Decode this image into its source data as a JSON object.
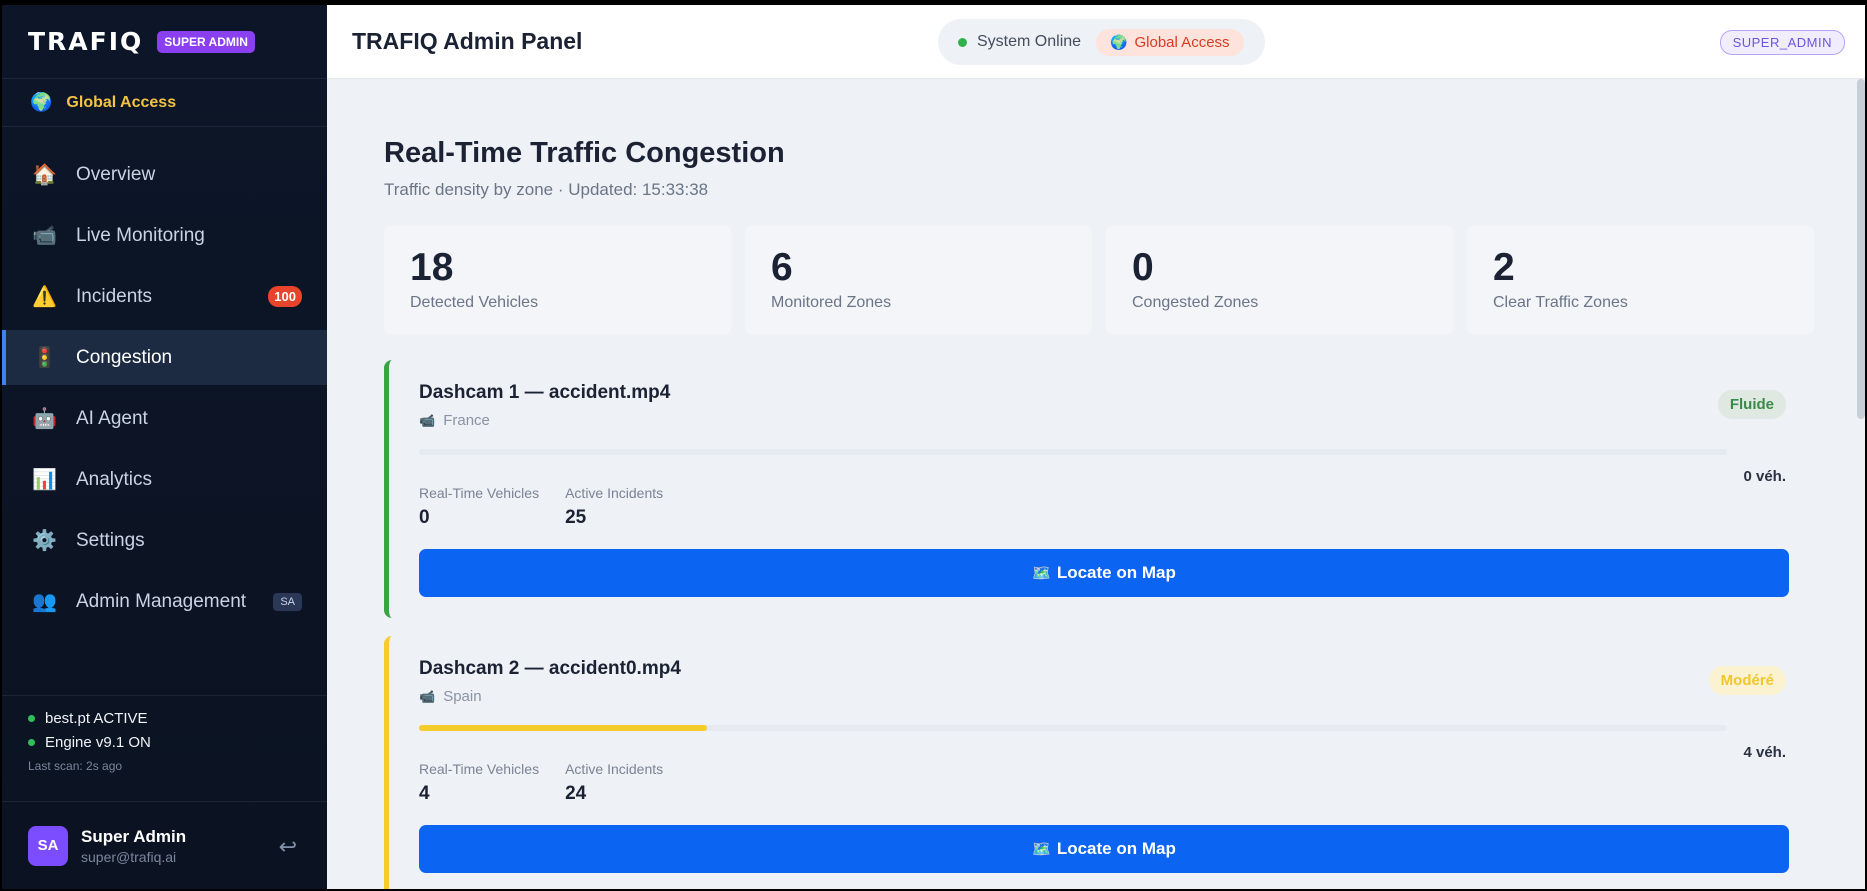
{
  "sidebar": {
    "logo": "TRAFIQ",
    "badge": "SUPER ADMIN",
    "scope": "Global Access",
    "items": [
      {
        "label": "Overview",
        "icon": "🏠"
      },
      {
        "label": "Live Monitoring",
        "icon": "📹"
      },
      {
        "label": "Incidents",
        "icon": "⚠️",
        "badge": "100"
      },
      {
        "label": "Congestion",
        "icon": "🚦"
      },
      {
        "label": "AI Agent",
        "icon": "🤖"
      },
      {
        "label": "Analytics",
        "icon": "📊"
      },
      {
        "label": "Settings",
        "icon": "⚙️"
      },
      {
        "label": "Admin Management",
        "icon": "👥",
        "badge": "SA"
      }
    ],
    "status": {
      "model": "best.pt ACTIVE",
      "engine": "Engine v9.1 ON",
      "last_scan": "Last scan: 2s ago"
    },
    "user": {
      "initials": "SA",
      "name": "Super Admin",
      "email": "super@trafiq.ai"
    }
  },
  "header": {
    "title": "TRAFIQ Admin Panel",
    "system_status": "System Online",
    "access": "Global Access",
    "role": "SUPER_ADMIN"
  },
  "page": {
    "title": "Real-Time Traffic Congestion",
    "subtitle": "Traffic density by zone · Updated: 15:33:38"
  },
  "stats": [
    {
      "value": "18",
      "label": "Detected Vehicles"
    },
    {
      "value": "6",
      "label": "Monitored Zones"
    },
    {
      "value": "0",
      "label": "Congested Zones"
    },
    {
      "value": "2",
      "label": "Clear Traffic Zones"
    }
  ],
  "cards": [
    {
      "title": "Dashcam 1 — accident.mp4",
      "location": "France",
      "status": "Fluide",
      "vehicles_label": "0 véh.",
      "density_fraction": 0.0,
      "metric1_label": "Real-Time Vehicles",
      "metric1_value": "0",
      "metric2_label": "Active Incidents",
      "metric2_value": "25",
      "button": "Locate on Map"
    },
    {
      "title": "Dashcam 2 — accident0.mp4",
      "location": "Spain",
      "status": "Modéré",
      "vehicles_label": "4 véh.",
      "density_fraction": 0.22,
      "metric1_label": "Real-Time Vehicles",
      "metric1_value": "4",
      "metric2_label": "Active Incidents",
      "metric2_value": "24",
      "button": "Locate on Map"
    }
  ],
  "colors": {
    "accent": "#0c64f2",
    "sidebar_bg": "#0d1628",
    "fluide": "#3aa345",
    "modere": "#f5cc2b",
    "incident_badge": "#e8442c"
  },
  "icons": {
    "globe": "🌍",
    "camera": "📹",
    "map": "🗺️",
    "logout": "↩"
  }
}
